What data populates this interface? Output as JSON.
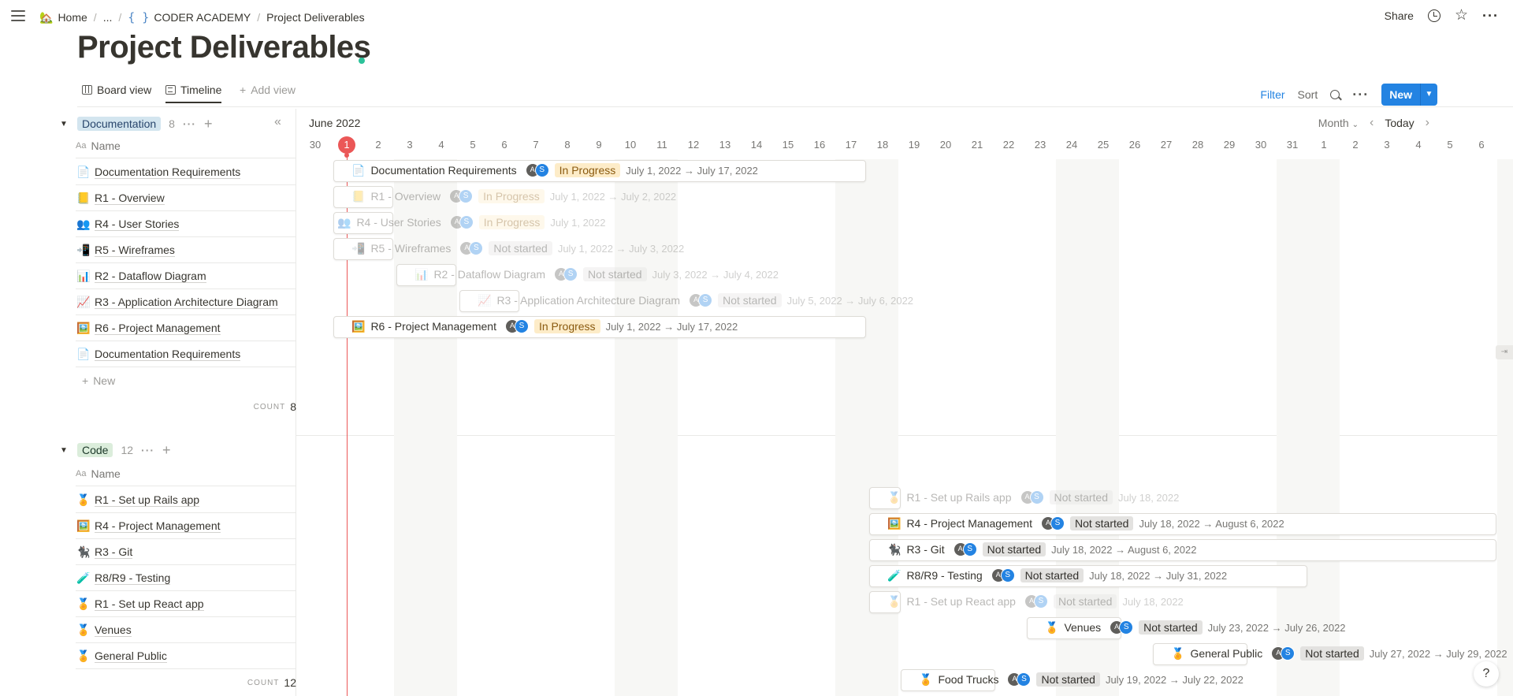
{
  "topbar": {
    "breadcrumbs": [
      {
        "icon": "house-emoji",
        "label": "Home"
      },
      {
        "label": "..."
      },
      {
        "icon": "code-braces-icon",
        "label": "CODER ACADEMY"
      },
      {
        "label": "Project Deliverables"
      }
    ],
    "share_label": "Share"
  },
  "page": {
    "title": "Project Deliverables"
  },
  "views": {
    "tabs": [
      {
        "label": "Board view",
        "icon": "board-icon"
      },
      {
        "label": "Timeline",
        "icon": "timeline-icon",
        "active": true
      }
    ],
    "add_view_label": "Add view",
    "filter_label": "Filter",
    "sort_label": "Sort",
    "new_label": "New"
  },
  "timeline": {
    "month_label": "June 2022",
    "scale_label": "Month",
    "today_label": "Today",
    "days": [
      "30",
      "1",
      "2",
      "3",
      "4",
      "5",
      "6",
      "7",
      "8",
      "9",
      "10",
      "11",
      "12",
      "13",
      "14",
      "15",
      "16",
      "17",
      "18",
      "19",
      "20",
      "21",
      "22",
      "23",
      "24",
      "25",
      "26",
      "27",
      "28",
      "29",
      "30",
      "31",
      "1",
      "2",
      "3",
      "4",
      "5",
      "6"
    ],
    "today_index": 1
  },
  "groups": [
    {
      "name": "Documentation",
      "count": "8",
      "name_column": "Name",
      "new_label": "New",
      "count_label": "COUNT",
      "count_value": "8",
      "rows": [
        {
          "emoji": "📄",
          "name": "Documentation Requirements",
          "status": "In Progress",
          "dates": "July 1, 2022 → July 17, 2022"
        },
        {
          "emoji": "📒",
          "name": "R1 - Overview",
          "status": "In Progress",
          "dates": "July 1, 2022 → July 2, 2022"
        },
        {
          "emoji": "👥",
          "name": "R4 - User Stories",
          "status": "In Progress",
          "dates": "July 1, 2022"
        },
        {
          "emoji": "📲",
          "name": "R5 - Wireframes",
          "status": "Not started",
          "dates": "July 1, 2022 → July 3, 2022"
        },
        {
          "emoji": "📊",
          "name": "R2 - Dataflow Diagram",
          "status": "Not started",
          "dates": "July 3, 2022 → July 4, 2022"
        },
        {
          "emoji": "📈",
          "name": "R3 - Application Architecture Diagram",
          "status": "Not started",
          "dates": "July 5, 2022 → July 6, 2022"
        },
        {
          "emoji": "🖼️",
          "name": "R6 - Project Management",
          "status": "In Progress",
          "dates": "July 1, 2022 → July 17, 2022"
        },
        {
          "emoji": "📄",
          "name": "Documentation Requirements"
        }
      ]
    },
    {
      "name": "Code",
      "count": "12",
      "name_column": "Name",
      "count_label": "COUNT",
      "count_value": "12",
      "rows": [
        {
          "emoji": "🏅",
          "name": "R1 - Set up Rails app",
          "status": "Not started",
          "dates": "July 18, 2022"
        },
        {
          "emoji": "🖼️",
          "name": "R4 - Project Management",
          "status": "Not started",
          "dates": "July 18, 2022 → August 6, 2022"
        },
        {
          "emoji": "🐈‍⬛",
          "name": "R3 - Git",
          "status": "Not started",
          "dates": "July 18, 2022 → August 6, 2022"
        },
        {
          "emoji": "🧪",
          "name": "R8/R9 - Testing",
          "status": "Not started",
          "dates": "July 18, 2022 → July 31, 2022"
        },
        {
          "emoji": "🏅",
          "name": "R1 - Set up React app",
          "status": "Not started",
          "dates": "July 18, 2022"
        },
        {
          "emoji": "🏅",
          "name": "Venues",
          "status": "Not started",
          "dates": "July 23, 2022 → July 26, 2022"
        },
        {
          "emoji": "🏅",
          "name": "General Public",
          "status": "Not started",
          "dates": "July 27, 2022 → July 29, 2022"
        },
        {
          "emoji": "🏅",
          "name": "Food Trucks",
          "status": "Not started",
          "dates": "July 19, 2022 → July 22, 2022"
        }
      ]
    }
  ],
  "avatars": {
    "photo": "A",
    "initial": "S"
  },
  "colors": {
    "accent": "#2383e2",
    "today": "#eb5757",
    "in_progress_bg": "#fdecc8",
    "not_started_bg": "#e3e2e0"
  },
  "help_label": "?"
}
